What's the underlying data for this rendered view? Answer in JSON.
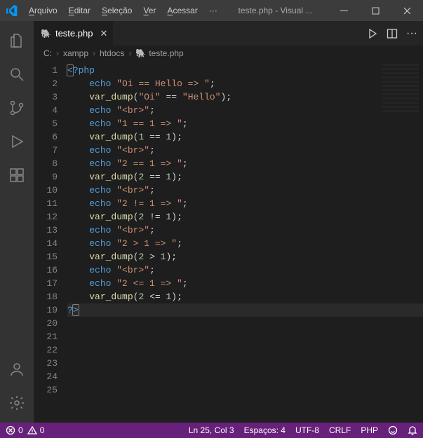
{
  "menu": {
    "arquivo": "Arquivo",
    "editar": "Editar",
    "selecao": "Seleção",
    "ver": "Ver",
    "acessar": "Acessar",
    "overflow": "···"
  },
  "window_title": "teste.php - Visual ...",
  "tab": {
    "label": "teste.php"
  },
  "breadcrumb": {
    "seg0": "C:",
    "seg1": "xampp",
    "seg2": "htdocs",
    "seg3": "teste.php"
  },
  "line_numbers": [
    "1",
    "2",
    "3",
    "4",
    "5",
    "6",
    "7",
    "8",
    "9",
    "10",
    "11",
    "12",
    "13",
    "14",
    "15",
    "16",
    "17",
    "18",
    "19",
    "20",
    "21",
    "22",
    "23",
    "24",
    "25"
  ],
  "code": {
    "l1_open": "<?php",
    "l2_echo": "echo",
    "l2_str": "\"Oi == Hello => \"",
    "l2_semi": ";",
    "l3_fn": "var_dump",
    "l3_lp": "(",
    "l3_s1": "\"Oi\"",
    "l3_op": " == ",
    "l3_s2": "\"Hello\"",
    "l3_rp": ")",
    "l3_semi": ";",
    "l4_echo": "echo",
    "l4_str": "\"<br>\"",
    "l4_semi": ";",
    "l6_echo": "echo",
    "l6_str": "\"1 == 1 => \"",
    "l6_semi": ";",
    "l7_fn": "var_dump",
    "l7_lp": "(",
    "l7_n1": "1",
    "l7_op": " == ",
    "l7_n2": "1",
    "l7_rp": ")",
    "l7_semi": ";",
    "l8_echo": "echo",
    "l8_str": "\"<br>\"",
    "l8_semi": ";",
    "l10_echo": "echo",
    "l10_str": "\"2 == 1 => \"",
    "l10_semi": ";",
    "l11_fn": "var_dump",
    "l11_lp": "(",
    "l11_n1": "2",
    "l11_op": " == ",
    "l11_n2": "1",
    "l11_rp": ")",
    "l11_semi": ";",
    "l12_echo": "echo",
    "l12_str": "\"<br>\"",
    "l12_semi": ";",
    "l14_echo": "echo",
    "l14_str": "\"2 != 1 => \"",
    "l14_semi": ";",
    "l15_fn": "var_dump",
    "l15_lp": "(",
    "l15_n1": "2",
    "l15_op": " != ",
    "l15_n2": "1",
    "l15_rp": ")",
    "l15_semi": ";",
    "l16_echo": "echo",
    "l16_str": "\"<br>\"",
    "l16_semi": ";",
    "l18_echo": "echo",
    "l18_str": "\"2 > 1 => \"",
    "l18_semi": ";",
    "l19_fn": "var_dump",
    "l19_lp": "(",
    "l19_n1": "2",
    "l19_op": " > ",
    "l19_n2": "1",
    "l19_rp": ")",
    "l19_semi": ";",
    "l20_echo": "echo",
    "l20_str": "\"<br>\"",
    "l20_semi": ";",
    "l22_echo": "echo",
    "l22_str": "\"2 <= 1 => \"",
    "l22_semi": ";",
    "l23_fn": "var_dump",
    "l23_lp": "(",
    "l23_n1": "2",
    "l23_op": " <= ",
    "l23_n2": "1",
    "l23_rp": ")",
    "l23_semi": ";",
    "l25_close_q": "?",
    "l25_close_gt": ">"
  },
  "status": {
    "errors": "0",
    "warnings": "0",
    "lncol": "Ln 25, Col 3",
    "spaces": "Espaços: 4",
    "encoding": "UTF-8",
    "eol": "CRLF",
    "language": "PHP"
  }
}
